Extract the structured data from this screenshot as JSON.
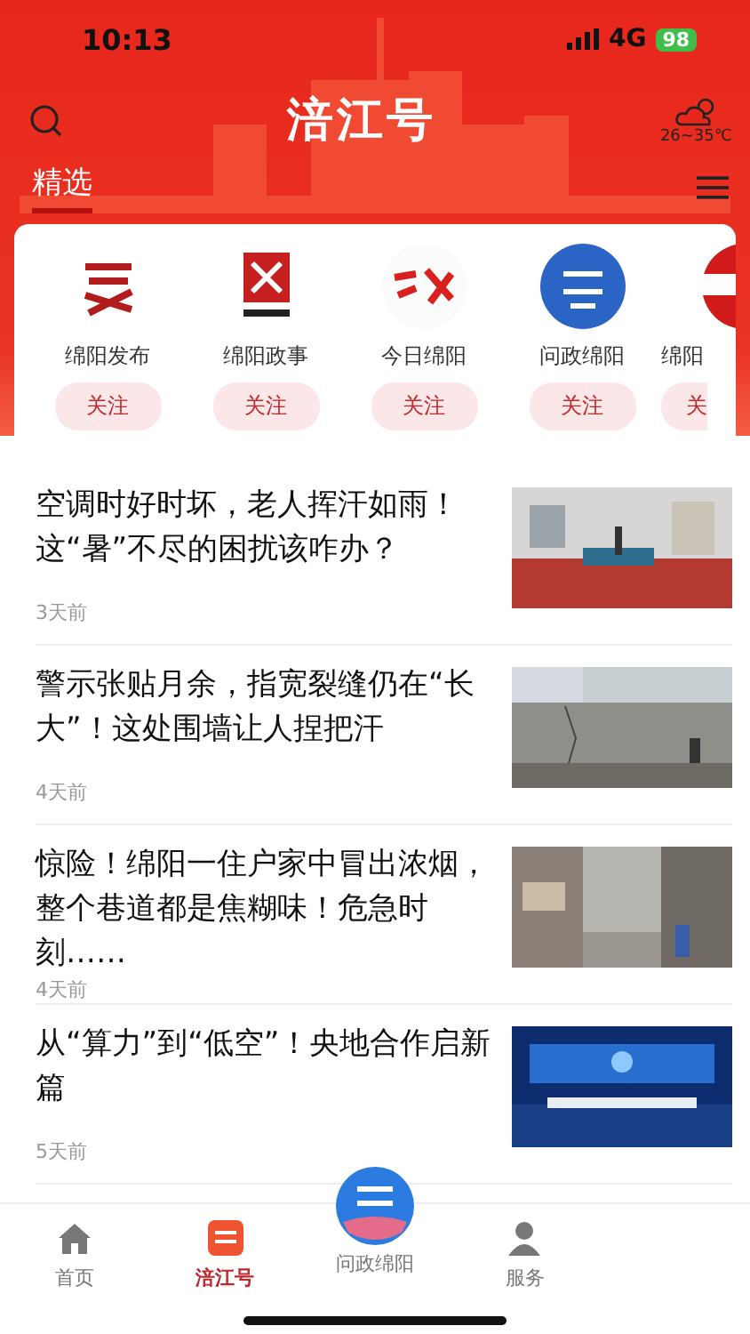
{
  "status_bar": {
    "time": "10:13",
    "network": "4G",
    "battery": "98"
  },
  "header": {
    "title": "涪江号",
    "weather": "26~35℃",
    "tabs": [
      {
        "label": "精选",
        "selected": true
      }
    ]
  },
  "accounts": [
    {
      "name": "绵阳发布",
      "follow": "关注"
    },
    {
      "name": "绵阳政事",
      "follow": "关注"
    },
    {
      "name": "今日绵阳",
      "follow": "关注"
    },
    {
      "name": "问政绵阳",
      "follow": "关注"
    },
    {
      "name": "绵阳",
      "follow": "关"
    }
  ],
  "articles": [
    {
      "title": "空调时好时坏，老人挥汗如雨！这“暑”不尽的困扰该咋办？",
      "time": "3天前"
    },
    {
      "title": "警示张贴月余，指宽裂缝仍在“长大”！这处围墙让人捏把汗",
      "time": "4天前"
    },
    {
      "title": "惊险！绵阳一住户家中冒出浓烟，整个巷道都是焦糊味！危急时刻……",
      "time": "4天前"
    },
    {
      "title": "从“算力”到“低空”！央地合作启新篇",
      "time": "5天前"
    }
  ],
  "bottom_nav": [
    {
      "label": "首页",
      "selected": false
    },
    {
      "label": "涪江号",
      "selected": true
    },
    {
      "label": "问政绵阳",
      "selected": false
    },
    {
      "label": "服务",
      "selected": false
    }
  ]
}
